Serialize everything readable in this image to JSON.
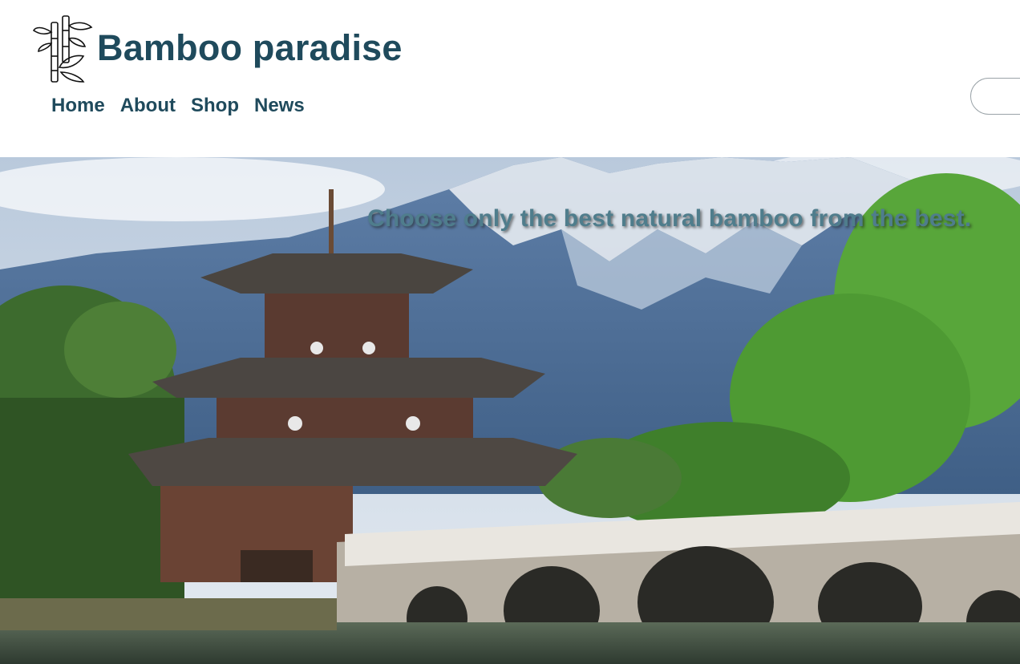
{
  "site": {
    "title": "Bamboo paradise",
    "logo_icon": "bamboo-icon"
  },
  "nav": {
    "items": [
      {
        "label": "Home"
      },
      {
        "label": "About"
      },
      {
        "label": "Shop"
      },
      {
        "label": "News"
      }
    ]
  },
  "search": {
    "value": "",
    "placeholder": ""
  },
  "hero": {
    "tagline": "Choose only the best natural bamboo from the best.",
    "image_icon": "pagoda-landscape-image"
  },
  "colors": {
    "brand": "#1f4a5c",
    "tagline": "#4f7d8c"
  }
}
